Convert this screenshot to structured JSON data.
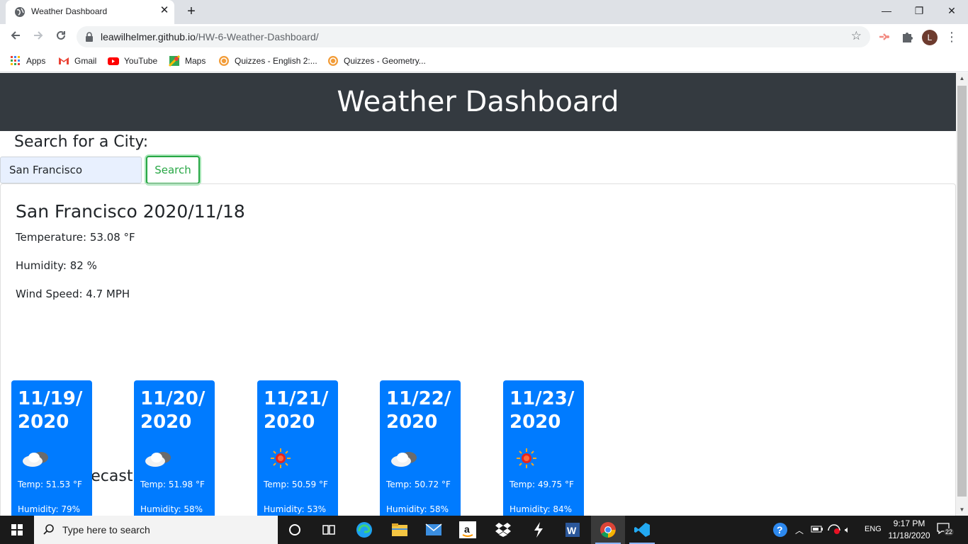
{
  "browser": {
    "tab_title": "Weather Dashboard",
    "tab_close": "✕",
    "new_tab": "+",
    "url_host": "leawilhelmer.github.io",
    "url_path": "/HW-6-Weather-Dashboard/",
    "avatar_letter": "L",
    "window_min": "—",
    "window_restore": "❐",
    "window_close": "✕",
    "bookmarks": [
      {
        "label": "Apps",
        "icon": "apps-grid-icon"
      },
      {
        "label": "Gmail",
        "icon": "gmail-icon"
      },
      {
        "label": "YouTube",
        "icon": "youtube-icon"
      },
      {
        "label": "Maps",
        "icon": "maps-icon"
      },
      {
        "label": "Quizzes - English 2:...",
        "icon": "quizizz-icon"
      },
      {
        "label": "Quizzes - Geometry...",
        "icon": "quizizz-icon"
      }
    ]
  },
  "header": {
    "title": "Weather Dashboard"
  },
  "search": {
    "label": "Search for a City:",
    "value": "San Francisco",
    "button": "Search"
  },
  "current": {
    "city_date": "San Francisco 2020/11/18",
    "temperature": "Temperature: 53.08 °F",
    "humidity": "Humidity: 82 %",
    "wind": "Wind Speed: 4.7 MPH"
  },
  "forecast": {
    "title": "5-Day Forecast:",
    "days": [
      {
        "date": "11/19/2020",
        "icon": "cloudy-icon",
        "temp": "Temp: 51.53 °F",
        "humidity": "Humidity: 79%"
      },
      {
        "date": "11/20/2020",
        "icon": "cloudy-icon",
        "temp": "Temp: 51.98 °F",
        "humidity": "Humidity: 58%"
      },
      {
        "date": "11/21/2020",
        "icon": "sun-icon",
        "temp": "Temp: 50.59 °F",
        "humidity": "Humidity: 53%"
      },
      {
        "date": "11/22/2020",
        "icon": "cloudy-icon",
        "temp": "Temp: 50.72 °F",
        "humidity": "Humidity: 58%"
      },
      {
        "date": "11/23/2020",
        "icon": "sun-icon",
        "temp": "Temp: 49.75 °F",
        "humidity": "Humidity: 84%"
      }
    ]
  },
  "taskbar": {
    "search_placeholder": "Type here to search",
    "lang": "ENG",
    "time": "9:17 PM",
    "date": "11/18/2020",
    "notifications": "22"
  },
  "colors": {
    "header_bg": "#343a40",
    "card_blue": "#007bff",
    "search_green": "#28a745"
  }
}
